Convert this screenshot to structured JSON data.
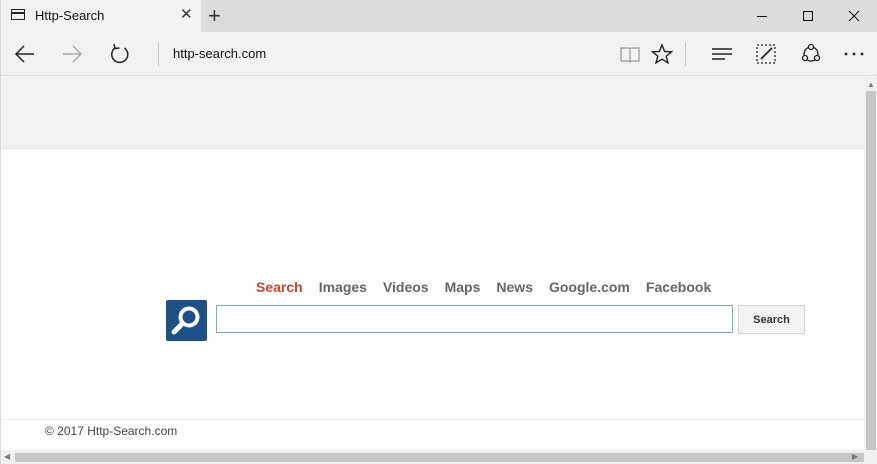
{
  "browser": {
    "tab_title": "Http-Search",
    "new_tab_label": "+",
    "url": "http-search.com"
  },
  "page": {
    "nav_links": [
      {
        "label": "Search",
        "active": true
      },
      {
        "label": "Images"
      },
      {
        "label": "Videos"
      },
      {
        "label": "Maps"
      },
      {
        "label": "News"
      },
      {
        "label": "Google.com"
      },
      {
        "label": "Facebook"
      }
    ],
    "search_value": "",
    "search_button": "Search",
    "footer": "© 2017 Http-Search.com"
  },
  "icons": {
    "tab": "tab-page-icon",
    "close_tab": "close-icon",
    "back": "back-arrow-icon",
    "forward": "forward-arrow-icon",
    "refresh": "refresh-icon",
    "reading_view": "book-icon",
    "favorite": "star-icon",
    "hub": "hub-lines-icon",
    "notes": "pen-note-icon",
    "share": "share-icon",
    "more": "more-dots-icon"
  },
  "colors": {
    "active_link": "#c8452b",
    "logo_bg": "#1e4f86",
    "input_border": "#7aa7d6"
  }
}
